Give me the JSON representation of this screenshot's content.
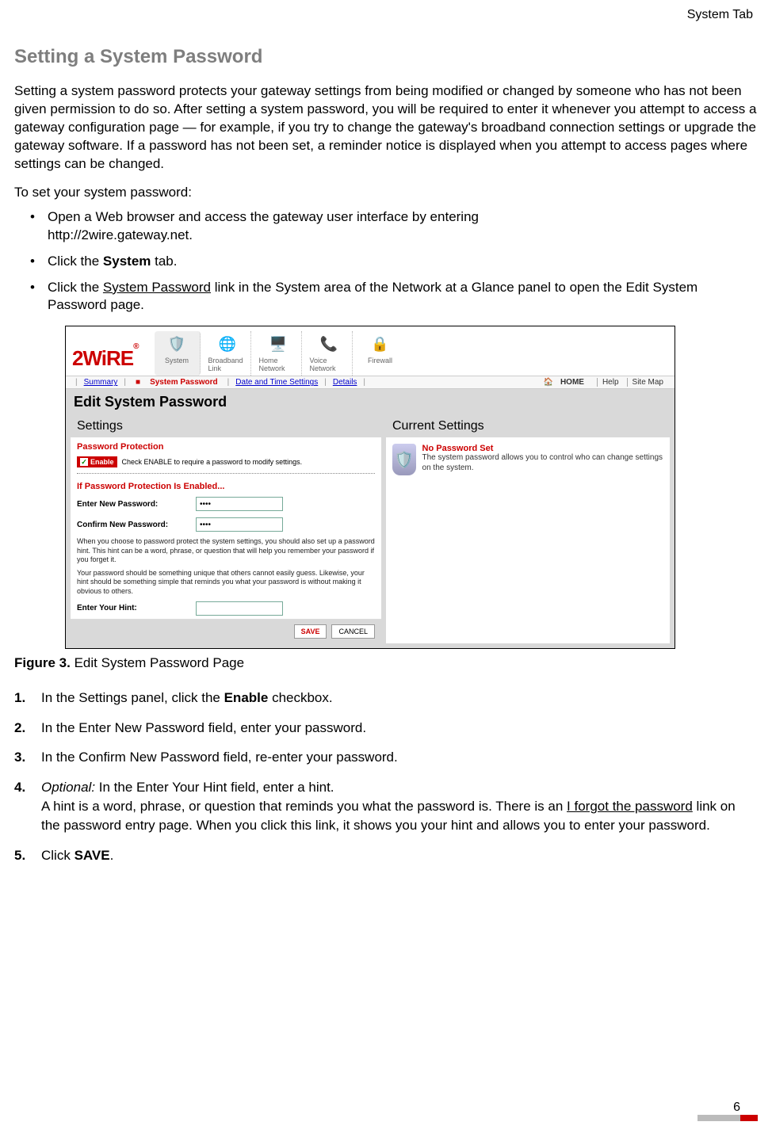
{
  "header_tab": "System Tab",
  "title": "Setting a System Password",
  "intro": "Setting a system password protects your gateway settings from being modified or changed by someone who has not been given permission to do so. After setting a system password, you will be required to enter it whenever you attempt to access a gateway configuration page — for example, if you try to change the gateway's broadband connection settings or upgrade the gateway software. If a password has not been set, a reminder notice is displayed when you attempt to access pages where settings can be changed.",
  "lead": "To set your system password:",
  "bullets": {
    "b1a": "Open a Web browser and access the gateway user interface by entering",
    "b1b": "http://2wire.gateway.net.",
    "b2a": "Click the ",
    "b2bold": "System",
    "b2c": " tab.",
    "b3a": "Click the ",
    "b3u": "System Password",
    "b3c": " link in the System area of the Network at a Glance panel to open the Edit System Password page."
  },
  "screenshot": {
    "logo": "2WiRE",
    "nav": {
      "system": "System",
      "broadband": "Broadband Link",
      "home": "Home Network",
      "voice": "Voice Network",
      "firewall": "Firewall"
    },
    "subnav": {
      "summary": "Summary",
      "syspw": "System Password",
      "datetime": "Date and Time Settings",
      "details": "Details",
      "home": "HOME",
      "help": "Help",
      "sitemap": "Site Map"
    },
    "page_title": "Edit System Password",
    "settings_hdr": "Settings",
    "current_hdr": "Current Settings",
    "pp_label": "Password Protection",
    "enable_label": "Enable",
    "enable_desc": "Check ENABLE to require a password to modify settings.",
    "if_enabled": "If Password Protection Is Enabled...",
    "enter_pw": "Enter New Password:",
    "confirm_pw": "Confirm New Password:",
    "pw_value": "••••",
    "hint_p1": "When you choose to password protect the system settings, you should also set up a password hint. This hint can be a word, phrase, or question that will help you remember your password if you forget it.",
    "hint_p2": "Your password should be something unique that others cannot easily guess. Likewise, your hint should be something simple that reminds you what your password is without making it obvious to others.",
    "enter_hint": "Enter Your Hint:",
    "save": "SAVE",
    "cancel": "CANCEL",
    "curr_title": "No Password Set",
    "curr_desc": "The system password allows you to control who can change settings on the system."
  },
  "fig_label": "Figure 3.",
  "fig_caption": " Edit System Password Page",
  "steps": {
    "s1a": "In the Settings panel, click the ",
    "s1b": "Enable",
    "s1c": " checkbox.",
    "s2": "In the Enter New Password field, enter your password.",
    "s3": "In the Confirm New Password field, re-enter your password.",
    "s4a": "Optional:",
    "s4b": " In the Enter Your Hint field, enter a hint.",
    "s4c": "A hint is a word, phrase, or question that reminds you what the password is. There is an ",
    "s4u": "I forgot the password",
    "s4d": " link on the password entry page. When you click this link, it shows you your hint and allows you to enter your password.",
    "s5a": "Click ",
    "s5b": "SAVE",
    "s5c": "."
  },
  "page_num": "6"
}
